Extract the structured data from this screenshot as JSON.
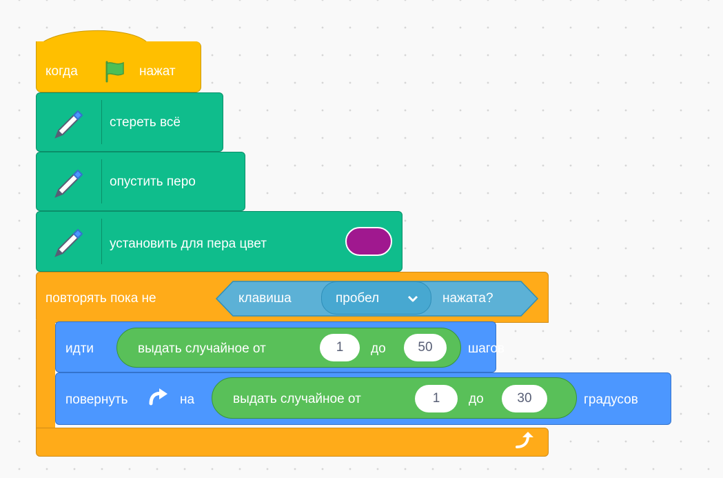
{
  "script": {
    "when_flag": {
      "prefix": "когда",
      "suffix": "нажат",
      "icon": "green-flag-icon"
    },
    "pen_clear": {
      "label": "стереть всё",
      "icon": "pen-icon"
    },
    "pen_down": {
      "label": "опустить перо",
      "icon": "pen-icon"
    },
    "pen_color": {
      "label": "установить для пера цвет",
      "color": "#A0188F",
      "icon": "pen-icon"
    },
    "repeat_until": {
      "label": "повторять пока не",
      "condition": {
        "prefix": "клавиша",
        "key": "пробел",
        "suffix": "нажата?"
      },
      "loop_icon": "loop-arrow-icon"
    },
    "move": {
      "label": "идти",
      "random": {
        "label": "выдать случайное от",
        "from": "1",
        "to_label": "до",
        "to": "50"
      },
      "suffix": "шагов"
    },
    "turn": {
      "label": "повернуть",
      "on_label": "на",
      "icon": "rotate-right-icon",
      "random": {
        "label": "выдать случайное от",
        "from": "1",
        "to_label": "до",
        "to": "30"
      },
      "suffix": "градусов"
    }
  },
  "colors": {
    "events": "#FFBF00",
    "pen": "#0FBD8C",
    "control": "#FFAB19",
    "motion": "#4C97FF",
    "operators": "#59C059",
    "sensing": "#5CB1D6"
  }
}
